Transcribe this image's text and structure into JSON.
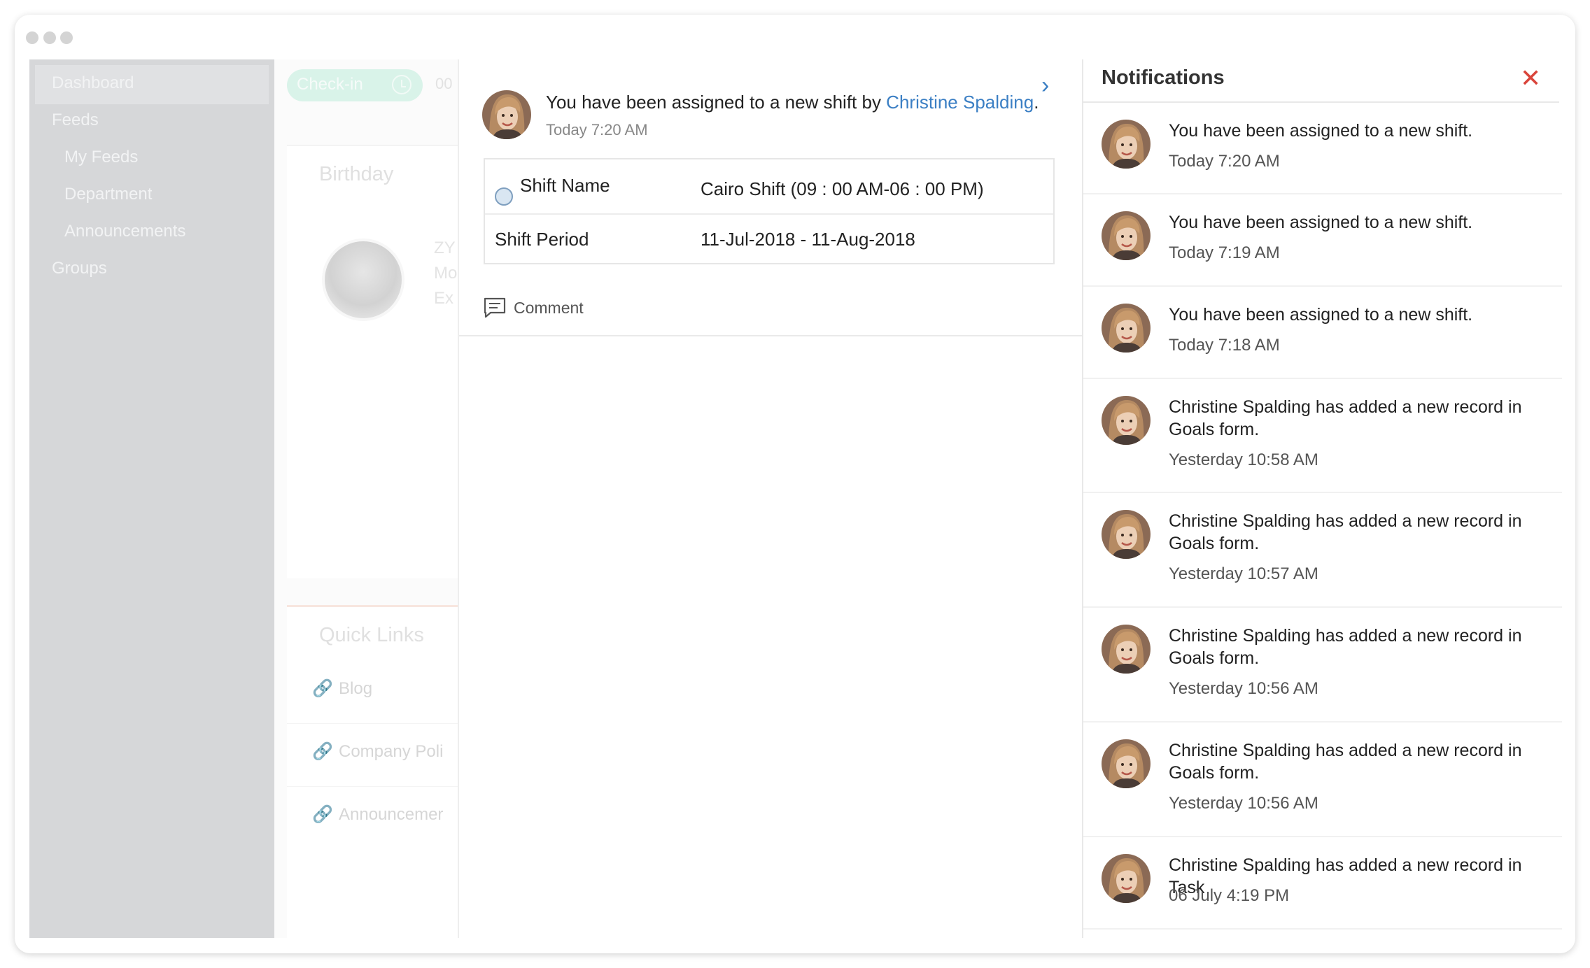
{
  "sidebar": {
    "items": [
      {
        "label": "Dashboard"
      },
      {
        "label": "Feeds"
      },
      {
        "label": "My Feeds"
      },
      {
        "label": "Department"
      },
      {
        "label": "Announcements"
      },
      {
        "label": "Groups"
      }
    ]
  },
  "background": {
    "checkin_label": "Check-in",
    "timer": "00",
    "birthday_title": "Birthday",
    "birthday_lines": [
      "ZY",
      "Mo",
      "Ex"
    ],
    "quick_links_title": "Quick Links",
    "quick_links": [
      {
        "label": "Blog"
      },
      {
        "label": "Company Poli"
      },
      {
        "label": "Announcemer"
      }
    ]
  },
  "detail": {
    "message_prefix": "You have been assigned to a new shift by ",
    "assigned_by": "Christine Spalding",
    "message_suffix": ".",
    "time": "Today 7:20 AM",
    "rows": [
      {
        "label": "Shift Name",
        "value": "Cairo Shift (09 : 00 AM-06 : 00 PM)"
      },
      {
        "label": "Shift Period",
        "value": "11-Jul-2018 - 11-Aug-2018"
      }
    ],
    "comment_label": "Comment"
  },
  "notifications": {
    "title": "Notifications",
    "items": [
      {
        "text": "You have been assigned to a new shift.",
        "time": "Today 7:20 AM"
      },
      {
        "text": "You have been assigned to a new shift.",
        "time": "Today 7:19 AM"
      },
      {
        "text": "You have been assigned to a new shift.",
        "time": "Today 7:18 AM"
      },
      {
        "text": "Christine Spalding has added a new record in Goals form.",
        "time": "Yesterday 10:58 AM"
      },
      {
        "text": "Christine Spalding has added a new record in Goals form.",
        "time": "Yesterday 10:57 AM"
      },
      {
        "text": "Christine Spalding has added a new record in Goals form.",
        "time": "Yesterday 10:56 AM"
      },
      {
        "text": "Christine Spalding has added a new record in Goals form.",
        "time": "Yesterday 10:56 AM"
      },
      {
        "text": "Christine Spalding has added a new record in Task",
        "time": "06 July 4:19 PM"
      }
    ]
  },
  "colors": {
    "link_blue": "#3b7fc4",
    "close_red": "#d9453b",
    "sidebar_gray": "#d6d7d9"
  }
}
